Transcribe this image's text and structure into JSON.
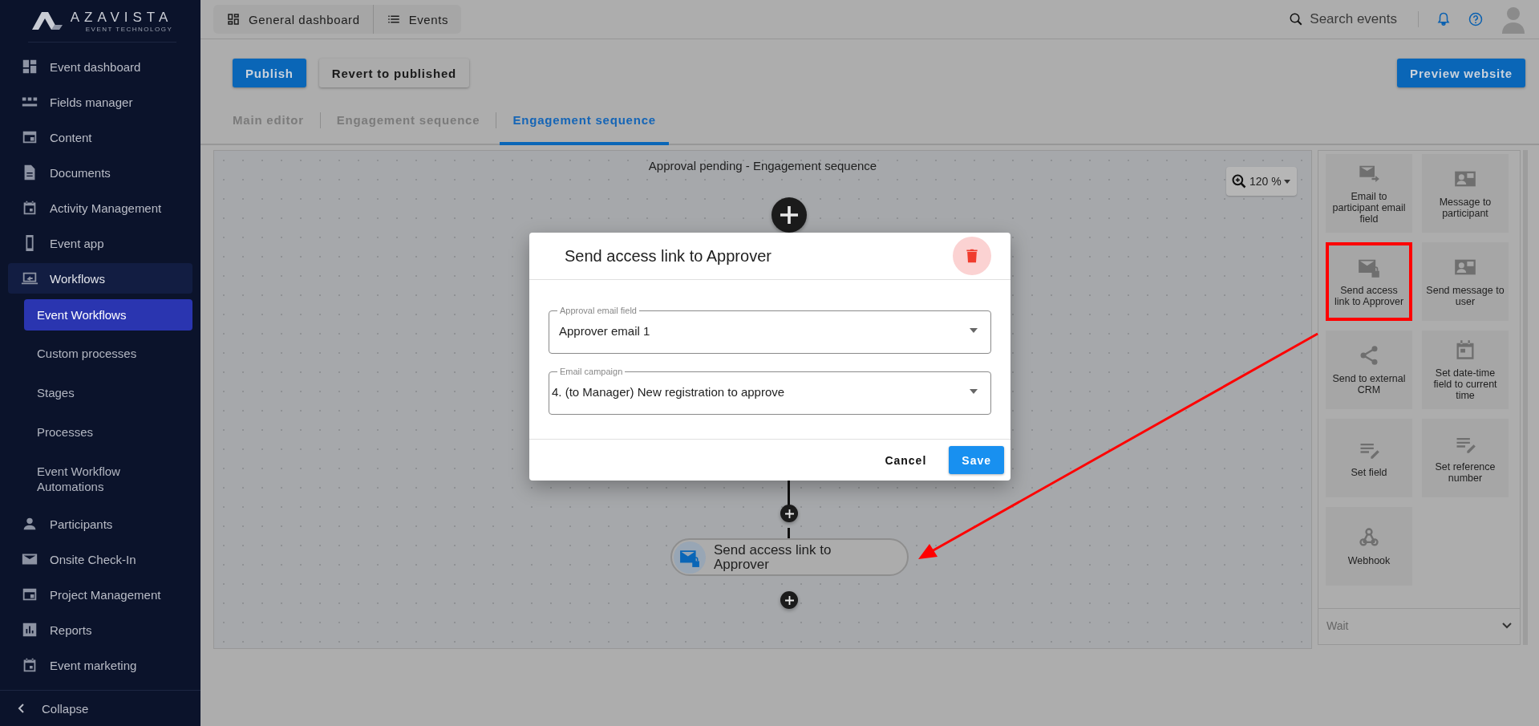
{
  "sidebar": {
    "logo": {
      "name": "AZAVISTA",
      "tagline": "EVENT TECHNOLOGY"
    },
    "items": [
      {
        "label": "Event dashboard",
        "selected": false,
        "expanded": false
      },
      {
        "label": "Fields manager",
        "selected": false,
        "expanded": false
      },
      {
        "label": "Content",
        "selected": false,
        "expanded": false
      },
      {
        "label": "Documents",
        "selected": false,
        "expanded": false
      },
      {
        "label": "Activity Management",
        "selected": false,
        "expanded": false
      },
      {
        "label": "Event app",
        "selected": false,
        "expanded": false
      },
      {
        "label": "Workflows",
        "selected": false,
        "expanded": true,
        "children": [
          {
            "label": "Event Workflows",
            "selected": true
          },
          {
            "label": "Custom processes",
            "selected": false
          },
          {
            "label": "Stages",
            "selected": false
          },
          {
            "label": "Processes",
            "selected": false
          },
          {
            "label": "Event Workflow Automations",
            "selected": false
          }
        ]
      },
      {
        "label": "Participants",
        "selected": false,
        "expanded": false
      },
      {
        "label": "Onsite Check-In",
        "selected": false,
        "expanded": false
      },
      {
        "label": "Project Management",
        "selected": false,
        "expanded": false
      },
      {
        "label": "Reports",
        "selected": false,
        "expanded": false
      },
      {
        "label": "Event marketing",
        "selected": false,
        "expanded": false
      }
    ],
    "collapse": "Collapse"
  },
  "top_bar": {
    "nav": [
      {
        "label": "General dashboard"
      },
      {
        "label": "Events"
      }
    ],
    "search": "Search events"
  },
  "toolbar": {
    "buttons": [
      {
        "label": "Publish",
        "kind": "primary"
      },
      {
        "label": "Revert to published",
        "kind": "secondary"
      }
    ],
    "preview": "Preview website"
  },
  "tabs": [
    {
      "label": "Main editor",
      "selected": false
    },
    {
      "label": "Engagement sequence",
      "selected": false
    },
    {
      "label": "Engagement sequence",
      "selected": true
    }
  ],
  "canvas": {
    "title": "Approval pending - Engagement sequence",
    "zoom": "120 %",
    "node": {
      "label": "Send access link to Approver"
    }
  },
  "palette": {
    "tiles": [
      {
        "label": "Email to participant email field",
        "highlighted": false
      },
      {
        "label": "Message to participant",
        "highlighted": false
      },
      {
        "label": "Send access link to Approver",
        "highlighted": true
      },
      {
        "label": "Send message to user",
        "highlighted": false
      },
      {
        "label": "Send to external CRM",
        "highlighted": false
      },
      {
        "label": "Set date-time field to current time",
        "highlighted": false
      },
      {
        "label": "Set field",
        "highlighted": false
      },
      {
        "label": "Set reference number",
        "highlighted": false
      },
      {
        "label": "Webhook",
        "highlighted": false
      }
    ],
    "sections": [
      {
        "label": "Wait",
        "expanded": false
      }
    ]
  },
  "modal": {
    "title": "Send access link to Approver",
    "fields": [
      {
        "label": "Approval email field",
        "value": "Approver email 1"
      },
      {
        "label": "Email campaign",
        "value": "4. (to Manager) New registration to approve"
      }
    ],
    "buttons": [
      {
        "label": "Cancel",
        "kind": "text"
      },
      {
        "label": "Save",
        "kind": "primary"
      }
    ]
  }
}
